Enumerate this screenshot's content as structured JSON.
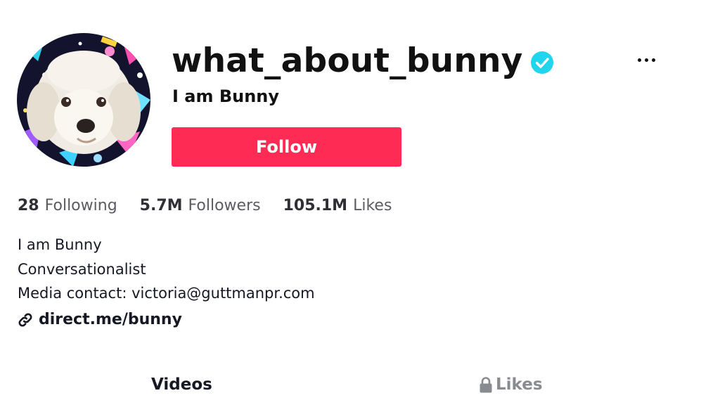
{
  "profile": {
    "username": "what_about_bunny",
    "nickname": "I am Bunny",
    "verified": true,
    "follow_label": "Follow"
  },
  "stats": [
    {
      "number": "28",
      "label": "Following"
    },
    {
      "number": "5.7M",
      "label": "Followers"
    },
    {
      "number": "105.1M",
      "label": "Likes"
    }
  ],
  "bio": {
    "lines": [
      "I am Bunny",
      "Conversationalist",
      "Media contact: victoria@guttmanpr.com"
    ],
    "link": "direct.me/bunny"
  },
  "tabs": [
    {
      "label": "Videos",
      "active": true
    },
    {
      "label": "Likes",
      "locked": true
    }
  ],
  "icons": {
    "verified": "verified-check-icon",
    "more": "more-dots-icon",
    "link": "link-icon",
    "lock": "lock-icon"
  },
  "colors": {
    "accent": "#fe2c55",
    "verified": "#20d5ec",
    "text": "#161823",
    "muted": "#8a8b91"
  }
}
